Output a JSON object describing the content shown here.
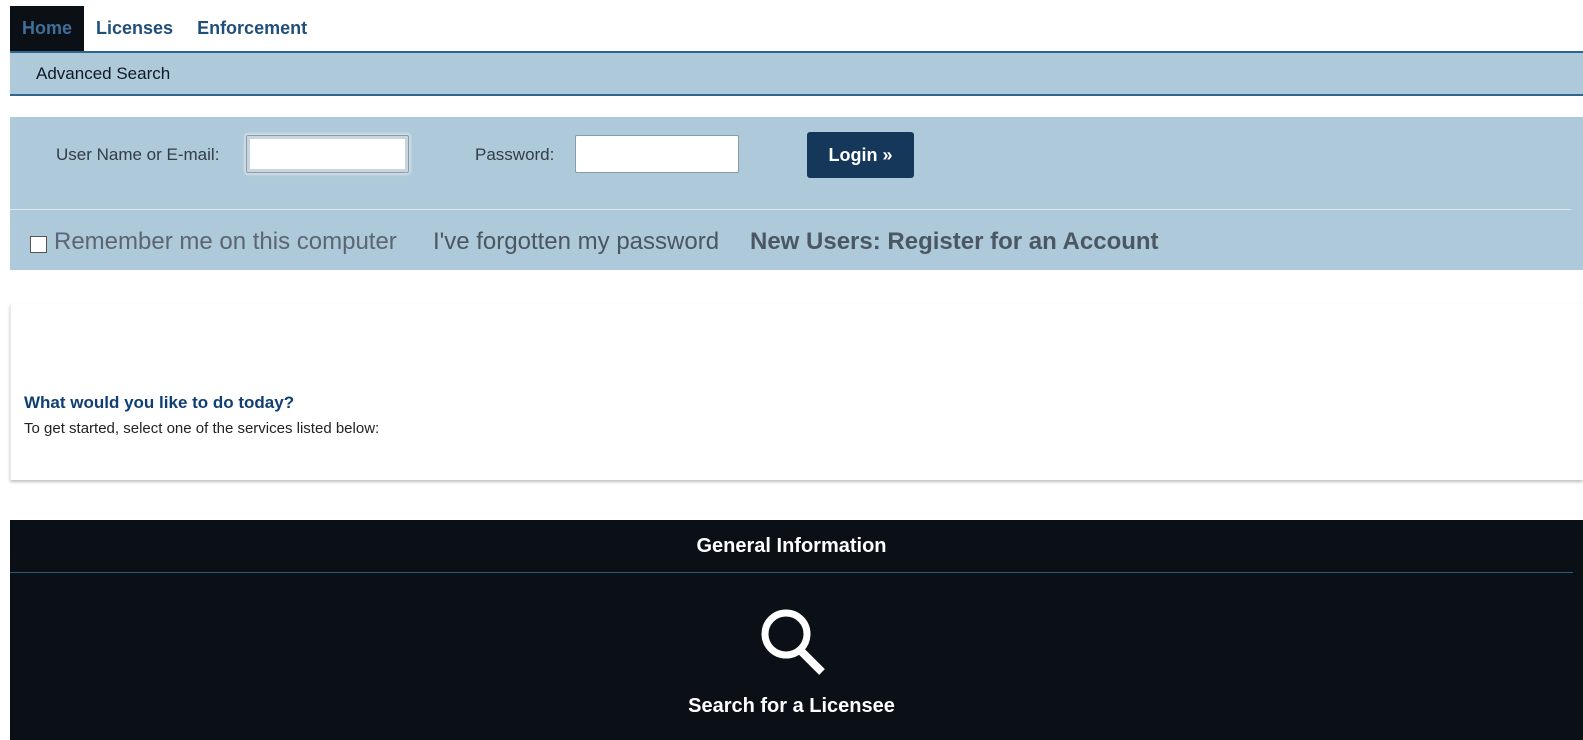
{
  "nav": {
    "tabs": [
      {
        "label": "Home",
        "active": true
      },
      {
        "label": "Licenses",
        "active": false
      },
      {
        "label": "Enforcement",
        "active": false
      }
    ],
    "sub_links": [
      "Advanced Search"
    ]
  },
  "login": {
    "username_label": "User Name or E-mail:",
    "username_value": "",
    "password_label": "Password:",
    "password_value": "",
    "login_button": "Login »",
    "remember_label": "Remember me on this computer",
    "remember_checked": false,
    "forgot_link": "I've forgotten my password",
    "register_link": "New Users: Register for an Account"
  },
  "welcome": {
    "heading": "What would you like to do today?",
    "subtext": "To get started, select one of the services listed below:"
  },
  "general": {
    "title": "General Information",
    "services": [
      {
        "label": "Search for a Licensee",
        "icon": "search-icon"
      }
    ]
  },
  "colors": {
    "accent_dark": "#15375a",
    "panel_blue": "#adc9da",
    "dark_bg": "#0b1016",
    "link_blue": "#1f4f7a"
  }
}
